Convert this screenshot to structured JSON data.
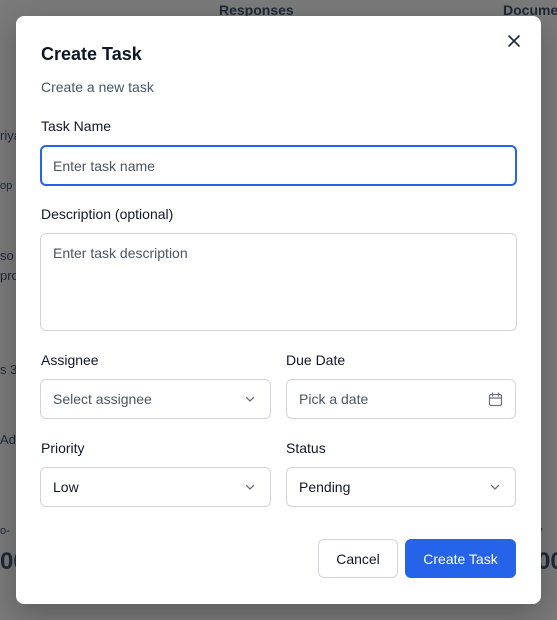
{
  "background": {
    "responses_tab": "Responses",
    "documents_tab": "Docume",
    "fragments": [
      "riya",
      "op",
      "so",
      "pro",
      "s 3",
      "Ad",
      "o-",
      "00",
      "y",
      "00"
    ]
  },
  "dialog": {
    "title": "Create Task",
    "subtitle": "Create a new task",
    "close_icon": "close-icon",
    "task_name": {
      "label": "Task Name",
      "placeholder": "Enter task name",
      "value": ""
    },
    "description": {
      "label": "Description (optional)",
      "placeholder": "Enter task description",
      "value": ""
    },
    "assignee": {
      "label": "Assignee",
      "placeholder": "Select assignee"
    },
    "due_date": {
      "label": "Due Date",
      "placeholder": "Pick a date"
    },
    "priority": {
      "label": "Priority",
      "value": "Low"
    },
    "status": {
      "label": "Status",
      "value": "Pending"
    },
    "cancel_label": "Cancel",
    "create_label": "Create Task"
  },
  "colors": {
    "accent": "#2563eb",
    "overlay": "#7a7a7a",
    "border": "#d1d5db"
  }
}
